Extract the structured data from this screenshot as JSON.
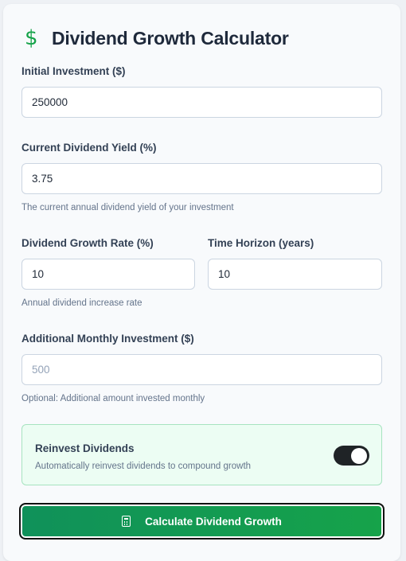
{
  "header": {
    "icon": "dollar-sign-icon",
    "icon_glyph": "$",
    "title": "Dividend Growth Calculator"
  },
  "fields": {
    "initial_investment": {
      "label": "Initial Investment ($)",
      "value": "250000"
    },
    "dividend_yield": {
      "label": "Current Dividend Yield (%)",
      "value": "3.75",
      "hint": "The current annual dividend yield of your investment"
    },
    "growth_rate": {
      "label": "Dividend Growth Rate (%)",
      "value": "10",
      "hint": "Annual dividend increase rate"
    },
    "time_horizon": {
      "label": "Time Horizon (years)",
      "value": "10"
    },
    "monthly_investment": {
      "label": "Additional Monthly Investment ($)",
      "placeholder": "500",
      "hint": "Optional: Additional amount invested monthly"
    }
  },
  "reinvest": {
    "title": "Reinvest Dividends",
    "description": "Automatically reinvest dividends to compound growth",
    "enabled": true
  },
  "actions": {
    "calculate_icon": "calculator-icon",
    "calculate_label": "Calculate Dividend Growth"
  },
  "colors": {
    "accent": "#16a34a",
    "accent_dark": "#10915a",
    "reinvest_bg": "#ecfdf3",
    "toggle_on": "#1f2326"
  }
}
